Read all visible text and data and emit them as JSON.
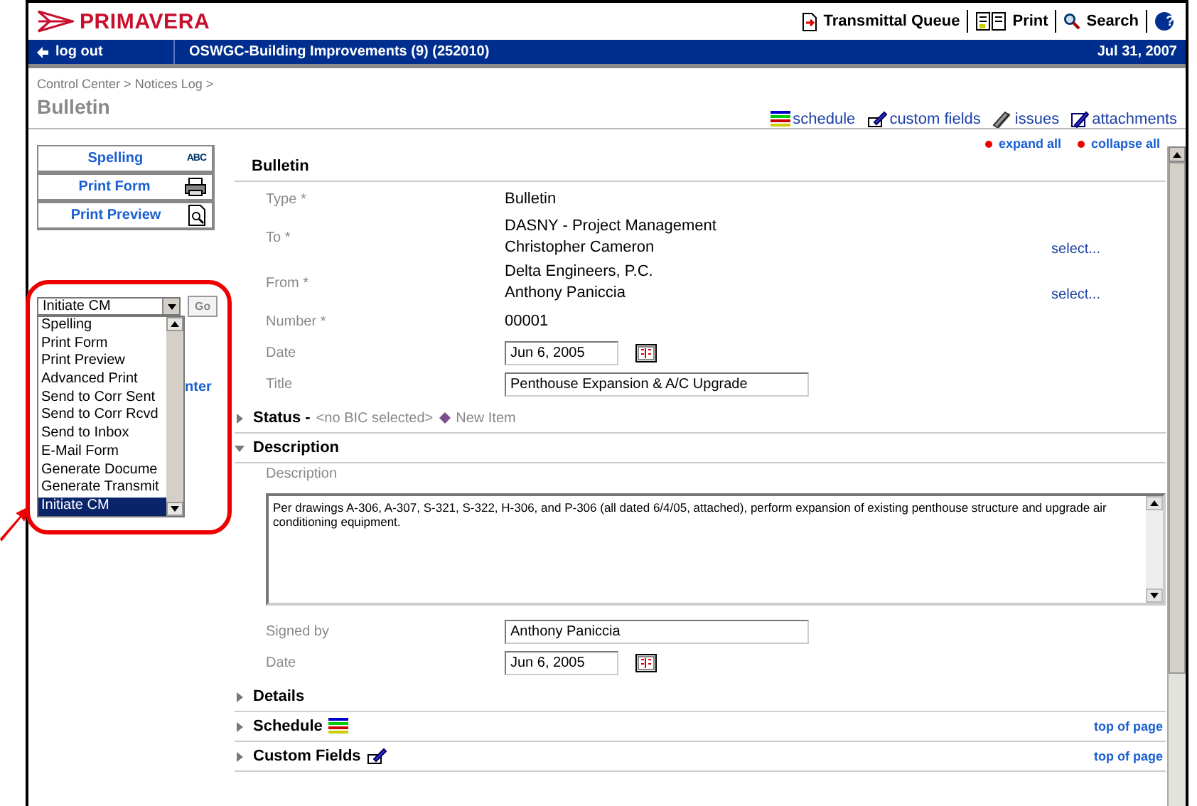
{
  "logo": "PRIMAVERA",
  "top_links": [
    {
      "kind": "transmittal",
      "label": "Transmittal Queue"
    },
    {
      "kind": "print",
      "label": "Print"
    },
    {
      "kind": "search",
      "label": "Search"
    }
  ],
  "nav_bar": {
    "logout": "log out",
    "project": "OSWGC-Building Improvements (9) (252010)",
    "date": "Jul 31, 2007"
  },
  "help": "?",
  "breadcrumb": [
    {
      "label": "Control Center",
      "separator": ">"
    },
    {
      "label": "Notices Log",
      "separator": ">"
    }
  ],
  "page_title": "Bulletin",
  "toolbar_links": [
    {
      "kind": "schedule",
      "label": "schedule"
    },
    {
      "kind": "custom",
      "label": "custom fields"
    },
    {
      "kind": "issues",
      "label": "issues"
    },
    {
      "kind": "attach",
      "label": "attachments"
    }
  ],
  "expand_all": "expand all",
  "collapse_all": "collapse all",
  "side_buttons": [
    {
      "kind": "spelling",
      "label": "Spelling",
      "icon_text": "ABC"
    },
    {
      "kind": "print",
      "label": "Print Form"
    },
    {
      "kind": "preview",
      "label": "Print Preview"
    }
  ],
  "action_dropdown": {
    "value": "Initiate CM",
    "go": "Go",
    "covered_link": "nter",
    "options": [
      {
        "label": "Spelling",
        "selected": false
      },
      {
        "label": "Print Form",
        "selected": false
      },
      {
        "label": "Print Preview",
        "selected": false
      },
      {
        "label": "Advanced Print",
        "selected": false
      },
      {
        "label": "Send to Corr Sent",
        "selected": false
      },
      {
        "label": "Send to Corr Rcvd",
        "selected": false
      },
      {
        "label": "Send to Inbox",
        "selected": false
      },
      {
        "label": "E-Mail Form",
        "selected": false
      },
      {
        "label": "Generate Docume",
        "selected": false
      },
      {
        "label": "Generate Transmit",
        "selected": false
      },
      {
        "label": "Initiate CM",
        "selected": true
      }
    ]
  },
  "form_title": "Bulletin",
  "fields": [
    {
      "kind": "static",
      "label": "Type *",
      "lines": [
        "Bulletin"
      ]
    },
    {
      "kind": "static",
      "label": "To *",
      "lines": [
        "DASNY - Project Management",
        "Christopher Cameron"
      ],
      "link": "select..."
    },
    {
      "kind": "static",
      "label": "From *",
      "lines": [
        "Delta Engineers, P.C.",
        "Anthony Paniccia"
      ],
      "link": "select..."
    },
    {
      "kind": "static",
      "label": "Number *",
      "lines": [
        "00001"
      ]
    },
    {
      "kind": "date",
      "label": "Date",
      "value": "Jun 6, 2005"
    },
    {
      "kind": "input",
      "label": "Title",
      "value": "Penthouse Expansion & A/C Upgrade"
    }
  ],
  "sections": [
    {
      "kind": "status",
      "title": "Status -",
      "note": "<no BIC selected>",
      "state": "New Item",
      "expanded": false
    },
    {
      "kind": "fields",
      "title": "Description",
      "expanded": true,
      "fields": [
        {
          "kind": "textarea",
          "label": "Description",
          "value": "Per drawings A-306, A-307, S-321, S-322, H-306, and P-306 (all dated 6/4/05, attached), perform expansion of existing penthouse structure and upgrade air conditioning equipment."
        },
        {
          "kind": "input",
          "label": "Signed by",
          "value": "Anthony Paniccia"
        },
        {
          "kind": "date",
          "label": "Date",
          "value": "Jun 6, 2005"
        }
      ]
    },
    {
      "kind": "plain",
      "title": "Details",
      "expanded": false
    },
    {
      "kind": "schedule",
      "title": "Schedule",
      "expanded": false,
      "top_link": "top of page"
    },
    {
      "kind": "custom",
      "title": "Custom Fields",
      "expanded": false,
      "top_link": "top of page"
    }
  ]
}
